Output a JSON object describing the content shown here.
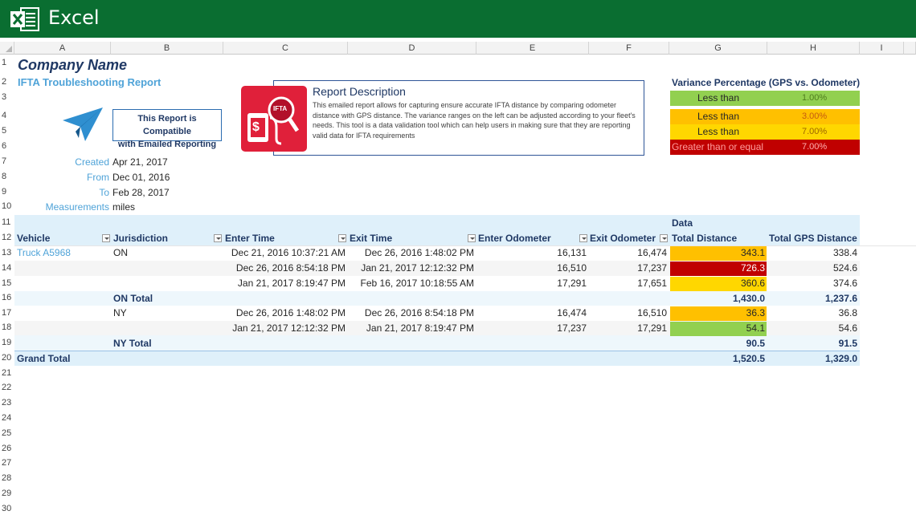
{
  "app": {
    "title": "Excel"
  },
  "columns": [
    "A",
    "B",
    "C",
    "D",
    "E",
    "F",
    "G",
    "H",
    "I"
  ],
  "rows": [
    "1",
    "2",
    "3",
    "4",
    "5",
    "6",
    "7",
    "8",
    "9",
    "10",
    "11",
    "12",
    "13",
    "14",
    "15",
    "16",
    "17",
    "18",
    "19",
    "20",
    "21",
    "22",
    "23",
    "24",
    "25",
    "26",
    "27",
    "28",
    "29",
    "30"
  ],
  "report": {
    "company": "Company Name",
    "title": "IFTA Troubleshooting Report",
    "compat_line1": "This Report is Compatible",
    "compat_line2": "with Emailed Reporting",
    "created_label": "Created",
    "created_value": "Apr 21, 2017",
    "from_label": "From",
    "from_value": "Dec 01, 2016",
    "to_label": "To",
    "to_value": "Feb 28, 2017",
    "measure_label": "Measurements",
    "measure_value": "miles"
  },
  "description": {
    "title": "Report Description",
    "text": "This emailed report allows for capturing ensure accurate IFTA distance by comparing odometer distance with GPS distance. The variance ranges on the left can be adjusted according to your fleet's needs. This tool is a data validation tool which can help users in making sure that they are reporting valid data for IFTA requirements",
    "icon_text": "IFTA"
  },
  "variance": {
    "title": "Variance Percentage (GPS vs. Odometer)",
    "rows": [
      {
        "label": "Less than",
        "value": "1.00%",
        "color": "#92d050"
      },
      {
        "label": "Less than",
        "value": "3.00%",
        "color": "#ffc000"
      },
      {
        "label": "Less than",
        "value": "7.00%",
        "color": "#ffd700"
      },
      {
        "label": "Greater than or equal",
        "value": "7.00%",
        "color": "#c00000"
      }
    ]
  },
  "pivot": {
    "data_label": "Data",
    "headers": {
      "vehicle": "Vehicle",
      "jurisdiction": "Jurisdiction",
      "enter_time": "Enter Time",
      "exit_time": "Exit Time",
      "enter_odo": "Enter Odometer",
      "exit_odo": "Exit Odometer",
      "total_distance": "Total Distance",
      "total_gps": "Total GPS Distance"
    },
    "rows": [
      {
        "vehicle": "Truck A5968",
        "jur": "ON",
        "enter": "Dec 21, 2016 10:37:21 AM",
        "exit": "Dec 26, 2016 1:48:02 PM",
        "eo": "16,131",
        "xo": "16,474",
        "td": "343.1",
        "gps": "338.4",
        "color": "#ffc000",
        "textcolor": "#262626"
      },
      {
        "vehicle": "",
        "jur": "",
        "enter": "Dec 26, 2016 8:54:18 PM",
        "exit": "Jan 21, 2017 12:12:32 PM",
        "eo": "16,510",
        "xo": "17,237",
        "td": "726.3",
        "gps": "524.6",
        "color": "#c00000",
        "textcolor": "#ffffff"
      },
      {
        "vehicle": "",
        "jur": "",
        "enter": "Jan 21, 2017 8:19:47 PM",
        "exit": "Feb 16, 2017 10:18:55 AM",
        "eo": "17,291",
        "xo": "17,651",
        "td": "360.6",
        "gps": "374.6",
        "color": "#ffd700",
        "textcolor": "#262626"
      }
    ],
    "on_total": {
      "label": "ON Total",
      "td": "1,430.0",
      "gps": "1,237.6"
    },
    "ny_rows": [
      {
        "jur": "NY",
        "enter": "Dec 26, 2016 1:48:02 PM",
        "exit": "Dec 26, 2016 8:54:18 PM",
        "eo": "16,474",
        "xo": "16,510",
        "td": "36.3",
        "gps": "36.8",
        "color": "#ffc000"
      },
      {
        "jur": "",
        "enter": "Jan 21, 2017 12:12:32 PM",
        "exit": "Jan 21, 2017 8:19:47 PM",
        "eo": "17,237",
        "xo": "17,291",
        "td": "54.1",
        "gps": "54.6",
        "color": "#92d050"
      }
    ],
    "ny_total": {
      "label": "NY Total",
      "td": "90.5",
      "gps": "91.5"
    },
    "grand_total": {
      "label": "Grand Total",
      "td": "1,520.5",
      "gps": "1,329.0"
    }
  }
}
